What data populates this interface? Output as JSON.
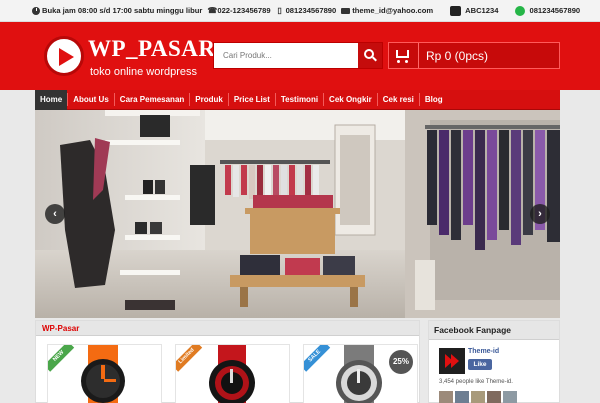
{
  "topbar": {
    "hours": "Buka jam 08:00 s/d 17:00 sabtu minggu libur",
    "phone1": "022-123456789",
    "phone2": "081234567890",
    "email": "theme_id@yahoo.com",
    "bbm": "ABC1234",
    "whatsapp": "081234567890"
  },
  "header": {
    "logo_title": "WP_PASAR",
    "logo_subtitle": "toko online wordpress",
    "search_placeholder": "Cari Produk...",
    "cart_label": "Rp 0 (0pcs)"
  },
  "nav": {
    "items": [
      {
        "label": "Home",
        "active": true
      },
      {
        "label": "About Us"
      },
      {
        "label": "Cara Pemesanan"
      },
      {
        "label": "Produk"
      },
      {
        "label": "Price List"
      },
      {
        "label": "Testimoni"
      },
      {
        "label": "Cek Ongkir"
      },
      {
        "label": "Cek resi"
      },
      {
        "label": "Blog"
      }
    ]
  },
  "slider": {
    "prev_icon": "‹",
    "next_icon": "›"
  },
  "main": {
    "title": "WP-Pasar",
    "products": [
      {
        "ribbon": "NEW",
        "ribbon_color": "#4aa64a",
        "strap_color": "#f46b12"
      },
      {
        "ribbon": "Limited",
        "ribbon_color": "#e07b22",
        "strap_color": "#c4161c"
      },
      {
        "ribbon": "SALE",
        "ribbon_color": "#3590d6",
        "strap_color": "#7b7b7b",
        "discount": "25%"
      }
    ]
  },
  "sidebar": {
    "title": "Facebook Fanpage",
    "fb_name": "Theme-id",
    "fb_like": "Like",
    "fb_count": "3,454 people like Theme-id."
  },
  "colors": {
    "brand_red": "#e01010",
    "nav_active": "#333333"
  }
}
